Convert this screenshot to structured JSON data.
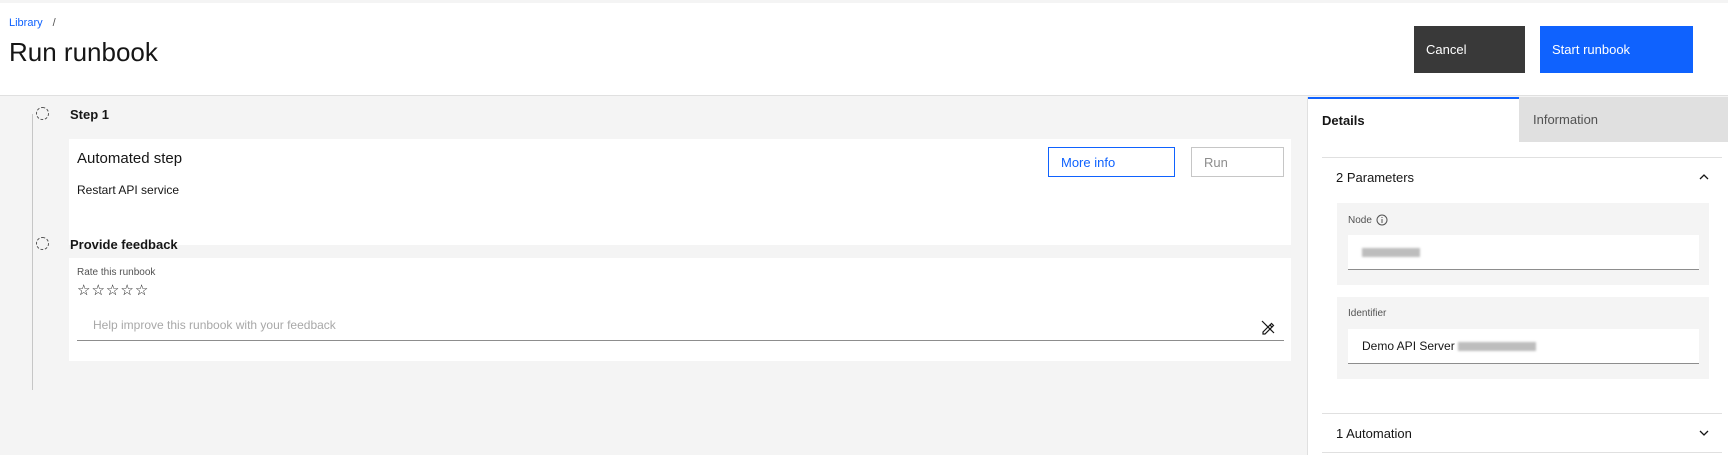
{
  "header": {
    "breadcrumb": [
      "Library",
      "/"
    ],
    "title": "Run runbook",
    "cancel_label": "Cancel",
    "start_label": "Start runbook"
  },
  "steps": [
    {
      "title": "Step 1",
      "card_heading": "Automated step",
      "card_desc": "Restart API service",
      "more_info_label": "More info",
      "run_label": "Run"
    },
    {
      "title": "Provide feedback",
      "rate_label": "Rate this runbook",
      "stars": 5,
      "rating": 0,
      "feedback_placeholder": "Help improve this runbook with your feedback"
    }
  ],
  "side": {
    "tabs": [
      "Details",
      "Information"
    ],
    "parameters_header": "2 Parameters",
    "node_label": "Node",
    "identifier_label": "Identifier",
    "identifier_value": "Demo API Server",
    "automation_header": "1 Automation"
  },
  "colors": {
    "accent": "#0f62fe",
    "cancel_bg": "#393939",
    "panel_bg": "#f4f4f4"
  }
}
